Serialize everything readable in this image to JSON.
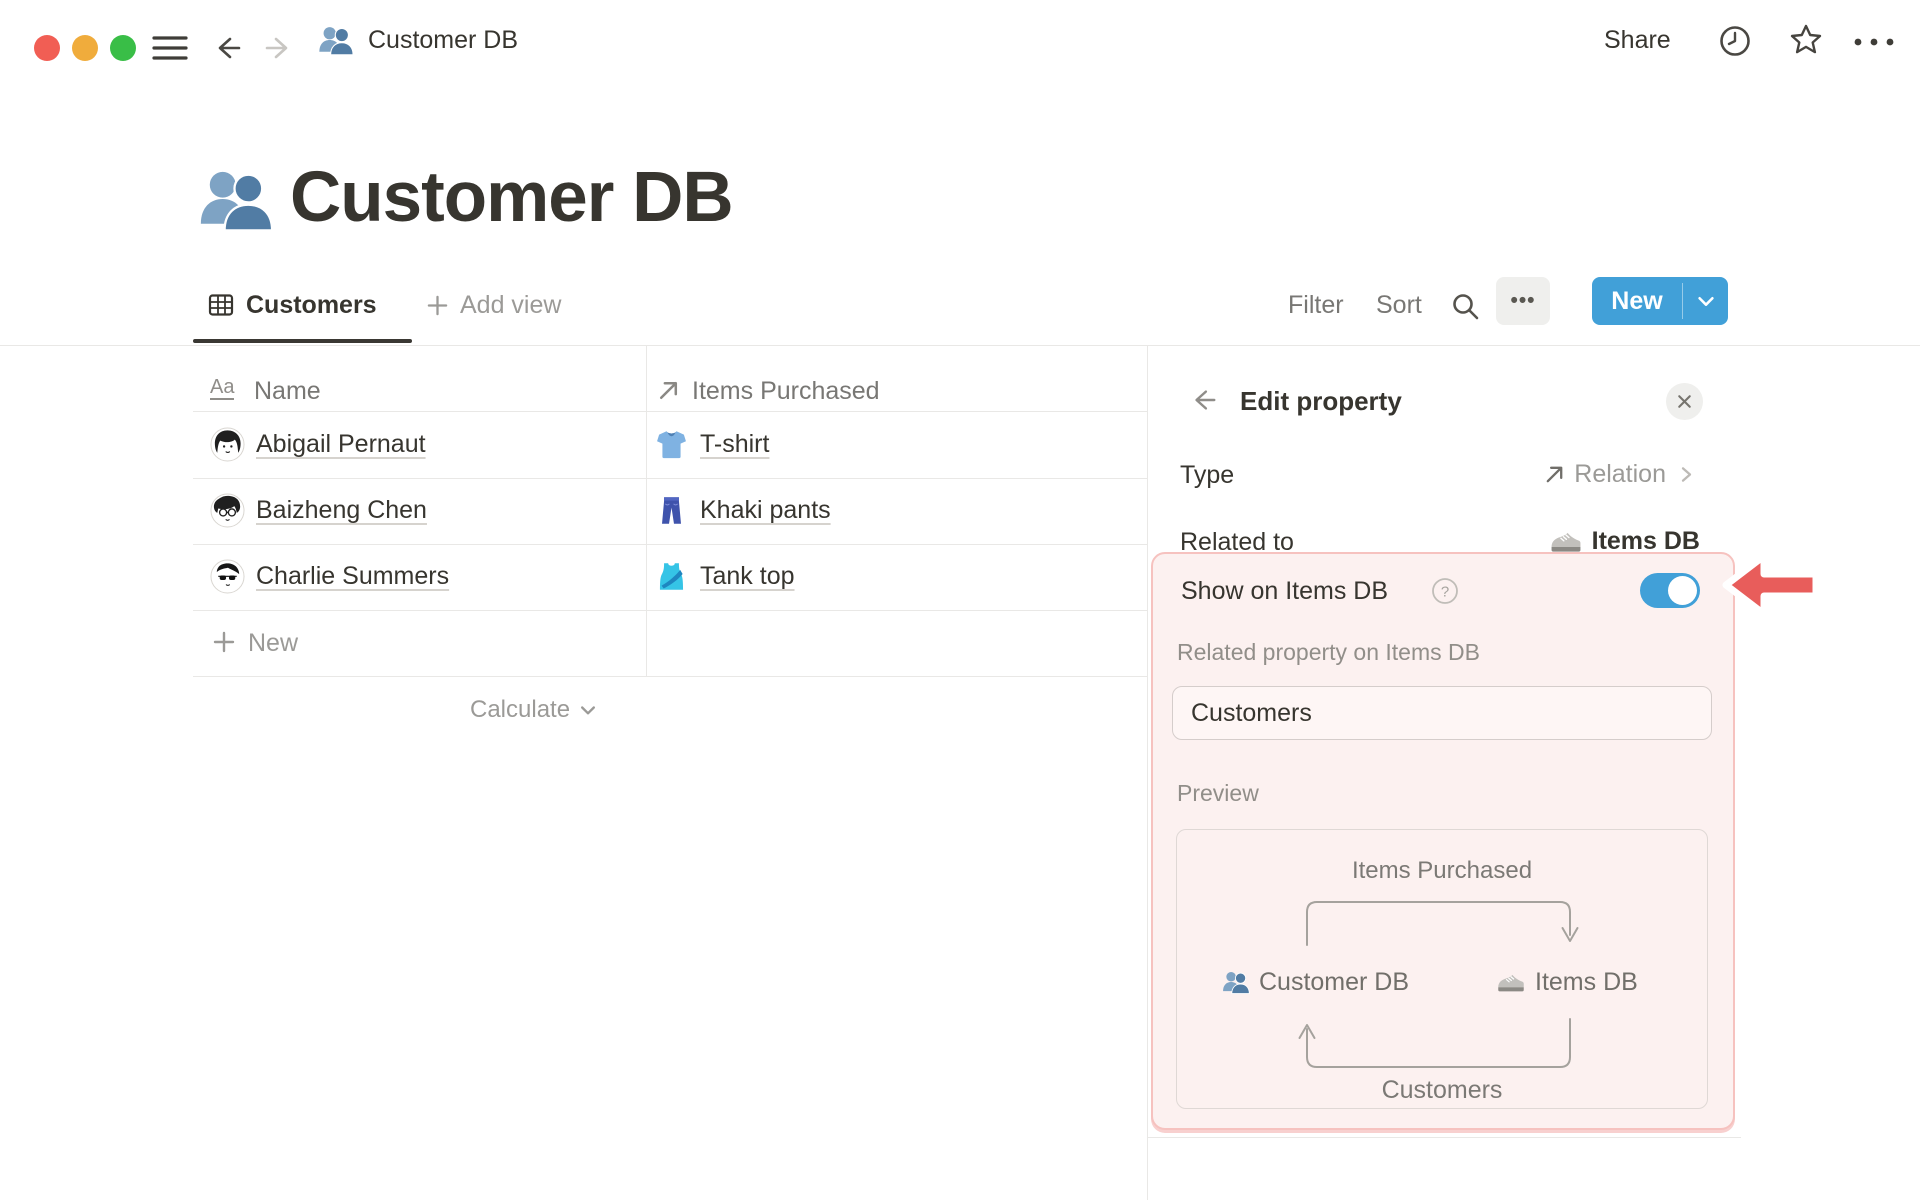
{
  "topbar": {
    "title": "Customer DB",
    "share": "Share"
  },
  "page": {
    "title": "Customer DB"
  },
  "view_bar": {
    "tab": "Customers",
    "add_view": "Add view",
    "filter": "Filter",
    "sort": "Sort",
    "more_glyph": "•••",
    "new_button": "New"
  },
  "table": {
    "aa_glyph": "Aa",
    "name_column": "Name",
    "items_column": "Items Purchased",
    "rows": [
      {
        "name": "Abigail Pernaut",
        "item": "T-shirt"
      },
      {
        "name": "Baizheng Chen",
        "item": "Khaki pants"
      },
      {
        "name": "Charlie Summers",
        "item": "Tank top"
      }
    ],
    "new_row": "New",
    "calculate": "Calculate"
  },
  "panel": {
    "title": "Edit property",
    "type_label": "Type",
    "type_value": "Relation",
    "related_label": "Related to",
    "related_value": "Items DB",
    "show_label": "Show on Items DB",
    "show_toggle_state": "on",
    "related_property_label": "Related property on Items DB",
    "related_property_value": "Customers",
    "preview_label": "Preview",
    "preview": {
      "top_label": "Items Purchased",
      "left_db": "Customer DB",
      "right_db": "Items DB",
      "bottom_label": "Customers"
    }
  },
  "colors": {
    "accent_blue": "#41A0D8",
    "text_dark": "#37352F",
    "text_gray": "#787774",
    "highlight_bg": "#FCF1F0",
    "highlight_border": "#F6C2BF",
    "arrow_red": "#E85D5B"
  }
}
